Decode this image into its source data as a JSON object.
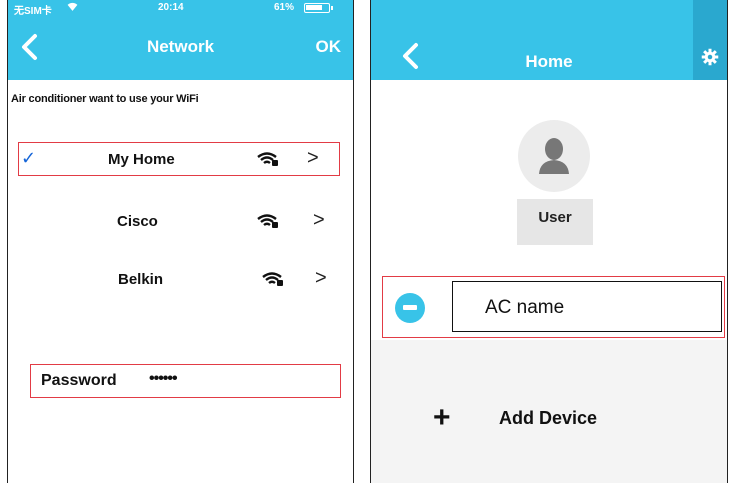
{
  "left_screen": {
    "status_bar": {
      "carrier": "无SIM卡",
      "time": "20:14",
      "battery": "61%"
    },
    "nav": {
      "title": "Network",
      "ok_label": "OK"
    },
    "prompt": "Air conditioner want to use your WiFi",
    "networks": [
      {
        "name": "My Home",
        "selected": true,
        "check": "✓",
        "chevron": ">"
      },
      {
        "name": "Cisco",
        "selected": false,
        "chevron": ">"
      },
      {
        "name": "Belkin",
        "selected": false,
        "chevron": ">"
      }
    ],
    "password": {
      "label": "Password",
      "value": "••••••"
    }
  },
  "right_screen": {
    "nav": {
      "title": "Home"
    },
    "user": {
      "label": "User"
    },
    "device": {
      "name": "AC name"
    },
    "add_device": {
      "plus": "+",
      "label": "Add Device"
    }
  },
  "colors": {
    "accent": "#38c3e8",
    "highlight": "#e23b45",
    "check": "#1565d8"
  },
  "icons": [
    "back-chevron-icon",
    "wifi-locked-icon",
    "chevron-right-icon",
    "checkmark-icon",
    "gear-icon",
    "user-avatar-icon",
    "ac-device-icon",
    "plus-icon"
  ]
}
